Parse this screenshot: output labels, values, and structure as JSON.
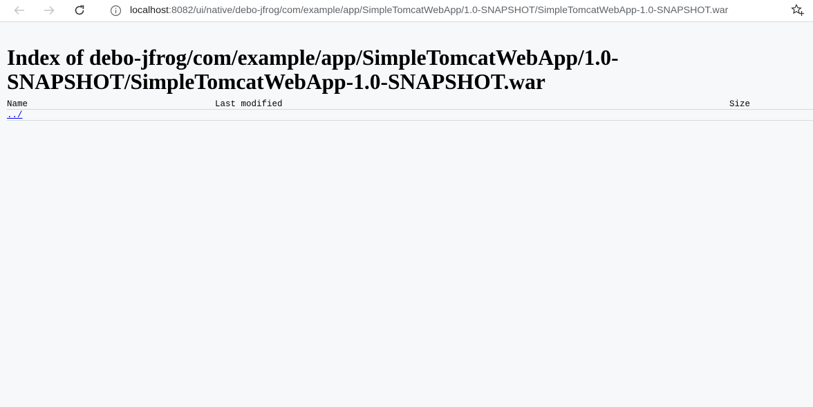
{
  "browser": {
    "url_host": "localhost",
    "url_rest": ":8082/ui/native/debo-jfrog/com/example/app/SimpleTomcatWebApp/1.0-SNAPSHOT/SimpleTomcatWebApp-1.0-SNAPSHOT.war",
    "icons": {
      "back": "arrow-left-icon",
      "forward": "arrow-right-icon",
      "reload": "reload-icon",
      "info": "info-icon",
      "favorites": "star-plus-icon"
    }
  },
  "page": {
    "title": "Index of debo-jfrog/com/example/app/SimpleTomcatWebApp/1.0-SNAPSHOT/SimpleTomcatWebApp-1.0-SNAPSHOT.war",
    "columns": {
      "name": "Name",
      "last_modified": "Last modified",
      "size": "Size"
    },
    "rows": [
      {
        "name": "../"
      }
    ]
  },
  "colors": {
    "link": "#0000ee",
    "page_bg": "#f7f8fa"
  }
}
